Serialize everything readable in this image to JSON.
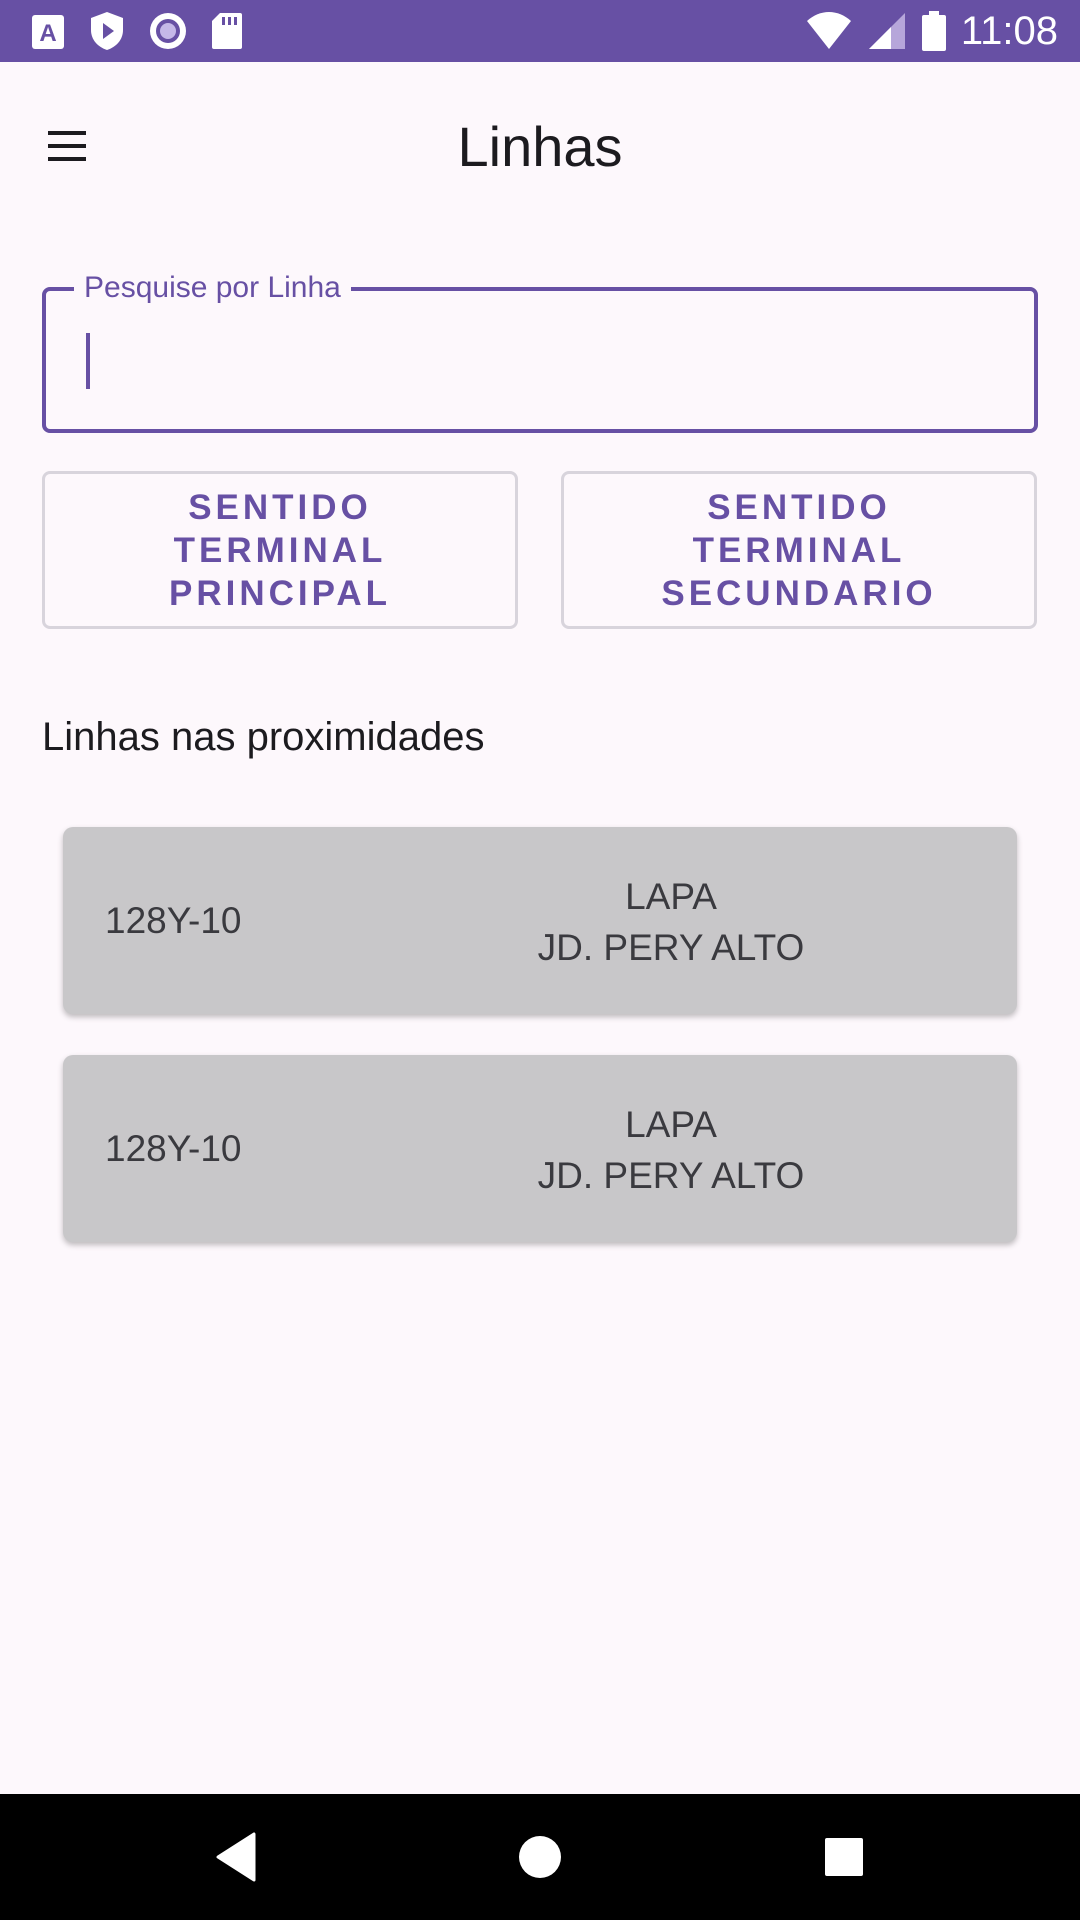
{
  "status_bar": {
    "time": "11:08",
    "left_icons": [
      "font-download-icon",
      "shield-play-icon",
      "radio-button-icon",
      "sd-card-icon"
    ],
    "right_icons": [
      "wifi-icon",
      "signal-icon",
      "battery-icon"
    ]
  },
  "app_bar": {
    "title": "Linhas",
    "menu_icon": "hamburger-menu-icon"
  },
  "search": {
    "label": "Pesquise por Linha",
    "value": ""
  },
  "direction_buttons": [
    {
      "label": "SENTIDO\nTERMINAL\nPRINCIPAL"
    },
    {
      "label": "SENTIDO\nTERMINAL\nSECUNDARIO"
    }
  ],
  "nearby": {
    "title": "Linhas nas proximidades",
    "lines": [
      {
        "code": "128Y-10",
        "terminal_1": "LAPA",
        "terminal_2": "JD. PERY ALTO"
      },
      {
        "code": "128Y-10",
        "terminal_1": "LAPA",
        "terminal_2": "JD. PERY ALTO"
      }
    ]
  },
  "nav_bar": {
    "icons": [
      "back-icon",
      "home-icon",
      "recents-icon"
    ]
  },
  "colors": {
    "primary": "#6750a4",
    "background": "#fdf8fc",
    "card": "#c8c7c9"
  }
}
